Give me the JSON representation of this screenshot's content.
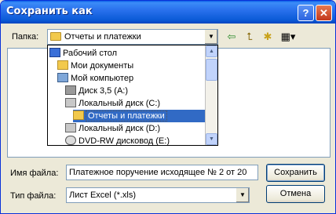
{
  "window": {
    "title": "Сохранить как",
    "help_glyph": "?",
    "close_glyph": "✕"
  },
  "folder": {
    "label": "Папка:",
    "value": "Отчеты и платежки"
  },
  "toolbar": {
    "back_glyph": "⇦",
    "up_glyph": "⮤",
    "new_folder_glyph": "✱",
    "views_glyph": "▦▾"
  },
  "dropdown_items": [
    {
      "label": "Рабочий стол",
      "icon": "desktop-icon"
    },
    {
      "label": "Мои документы",
      "icon": "documents-folder-icon"
    },
    {
      "label": "Мой компьютер",
      "icon": "computer-icon"
    },
    {
      "label": "Диск 3,5 (A:)",
      "icon": "floppy-drive-icon"
    },
    {
      "label": "Локальный диск (C:)",
      "icon": "hard-drive-icon"
    },
    {
      "label": "Отчеты и платежки",
      "icon": "folder-icon",
      "selected": true
    },
    {
      "label": "Локальный диск (D:)",
      "icon": "hard-drive-icon"
    },
    {
      "label": "DVD-RW дисковод (E:)",
      "icon": "dvd-drive-icon"
    }
  ],
  "filename": {
    "label": "Имя файла:",
    "value": "Платежное поручение исходящее № 2 от 20"
  },
  "filetype": {
    "label": "Тип файла:",
    "value": "Лист Excel (*.xls)"
  },
  "buttons": {
    "save": "Сохранить",
    "cancel": "Отмена"
  },
  "colors": {
    "title_bar": "#2a71ed",
    "selection": "#316ac5",
    "dialog_bg": "#ece9d8"
  }
}
